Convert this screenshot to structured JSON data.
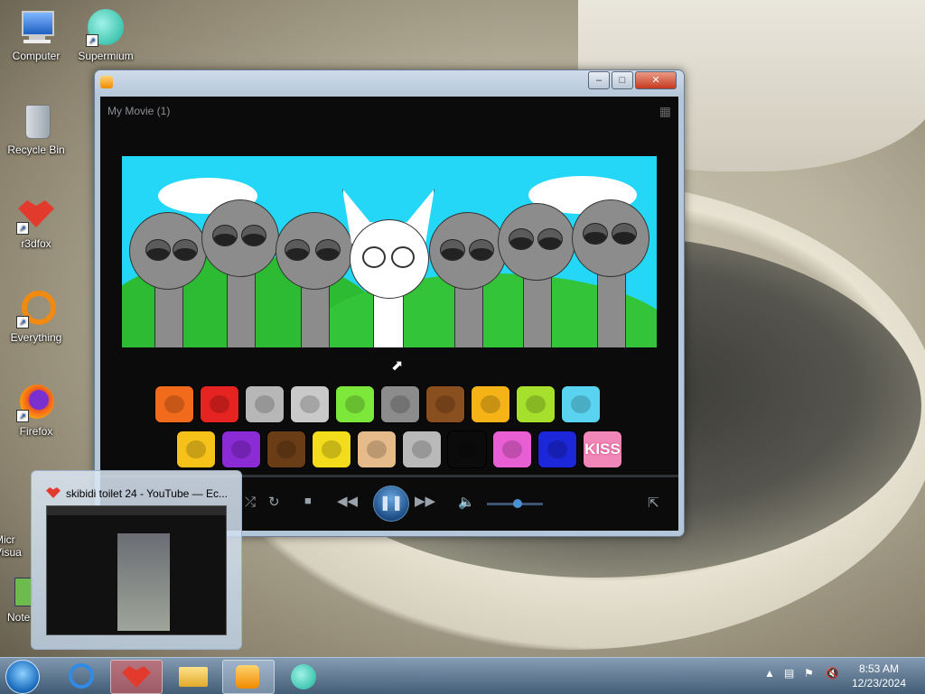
{
  "desktop": {
    "icons": [
      {
        "label": "Computer",
        "icon": "computer-icon"
      },
      {
        "label": "Supermium",
        "icon": "supermium-icon"
      },
      {
        "label": "Recycle Bin",
        "icon": "recycle-bin-icon"
      },
      {
        "label": "r3dfox",
        "icon": "r3dfox-icon"
      },
      {
        "label": "Everything",
        "icon": "everything-icon"
      },
      {
        "label": "Firefox",
        "icon": "firefox-icon"
      },
      {
        "label": "Micr\nVisua",
        "icon": "visual-studio-icon"
      },
      {
        "label": "Note",
        "icon": "notepad-icon"
      }
    ]
  },
  "player": {
    "title": "My Movie (1)",
    "volume": 0.55,
    "colors": {
      "accent": "#2a73c6",
      "background": "#0b0b0c"
    }
  },
  "sound_buttons_row1": [
    {
      "icon": "orange-frown-icon",
      "color": "#f26b1c"
    },
    {
      "icon": "red-mouth-icon",
      "color": "#e52320"
    },
    {
      "icon": "silver-disc-icon",
      "color": "#b7b7b7"
    },
    {
      "icon": "monitor-robot-icon",
      "color": "#c9c9c9"
    },
    {
      "icon": "flower-icon",
      "color": "#7ee83a"
    },
    {
      "icon": "cat-ears-icon",
      "color": "#8c8c8c"
    },
    {
      "icon": "brown-paper-icon",
      "color": "#8a4f1e"
    },
    {
      "icon": "yellow-glasses-icon",
      "color": "#f5b318"
    },
    {
      "icon": "green-spikes-icon",
      "color": "#a7e02c"
    },
    {
      "icon": "blue-bear-icon",
      "color": "#5ad3f0"
    }
  ],
  "sound_buttons_row2": [
    {
      "icon": "sun-icon",
      "color": "#f6c21a"
    },
    {
      "icon": "purple-icon",
      "color": "#8a2bd6"
    },
    {
      "icon": "tree-icon",
      "color": "#6b3d17"
    },
    {
      "icon": "yellow-drops-icon",
      "color": "#f3dc1c"
    },
    {
      "icon": "hat-icon",
      "color": "#e6ba8a"
    },
    {
      "icon": "tv-icon",
      "color": "#b9b9b9"
    },
    {
      "icon": "crown-icon",
      "color": "#0b0b0c"
    },
    {
      "icon": "pink-bow-icon",
      "color": "#e85fd4"
    },
    {
      "icon": "dark-blue-icon",
      "color": "#1b27d9"
    },
    {
      "label": "KISS",
      "icon": "kiss-icon",
      "color": "#f186b8"
    }
  ],
  "thumbnail": {
    "title": "skibidi toilet 24 - YouTube — Ec..."
  },
  "taskbar": {
    "time": "8:53 AM",
    "date": "12/23/2024",
    "apps": [
      {
        "icon": "ie-icon"
      },
      {
        "icon": "r3dfox-icon"
      },
      {
        "icon": "explorer-icon"
      },
      {
        "icon": "media-player-icon"
      },
      {
        "icon": "supermium-icon"
      }
    ]
  }
}
